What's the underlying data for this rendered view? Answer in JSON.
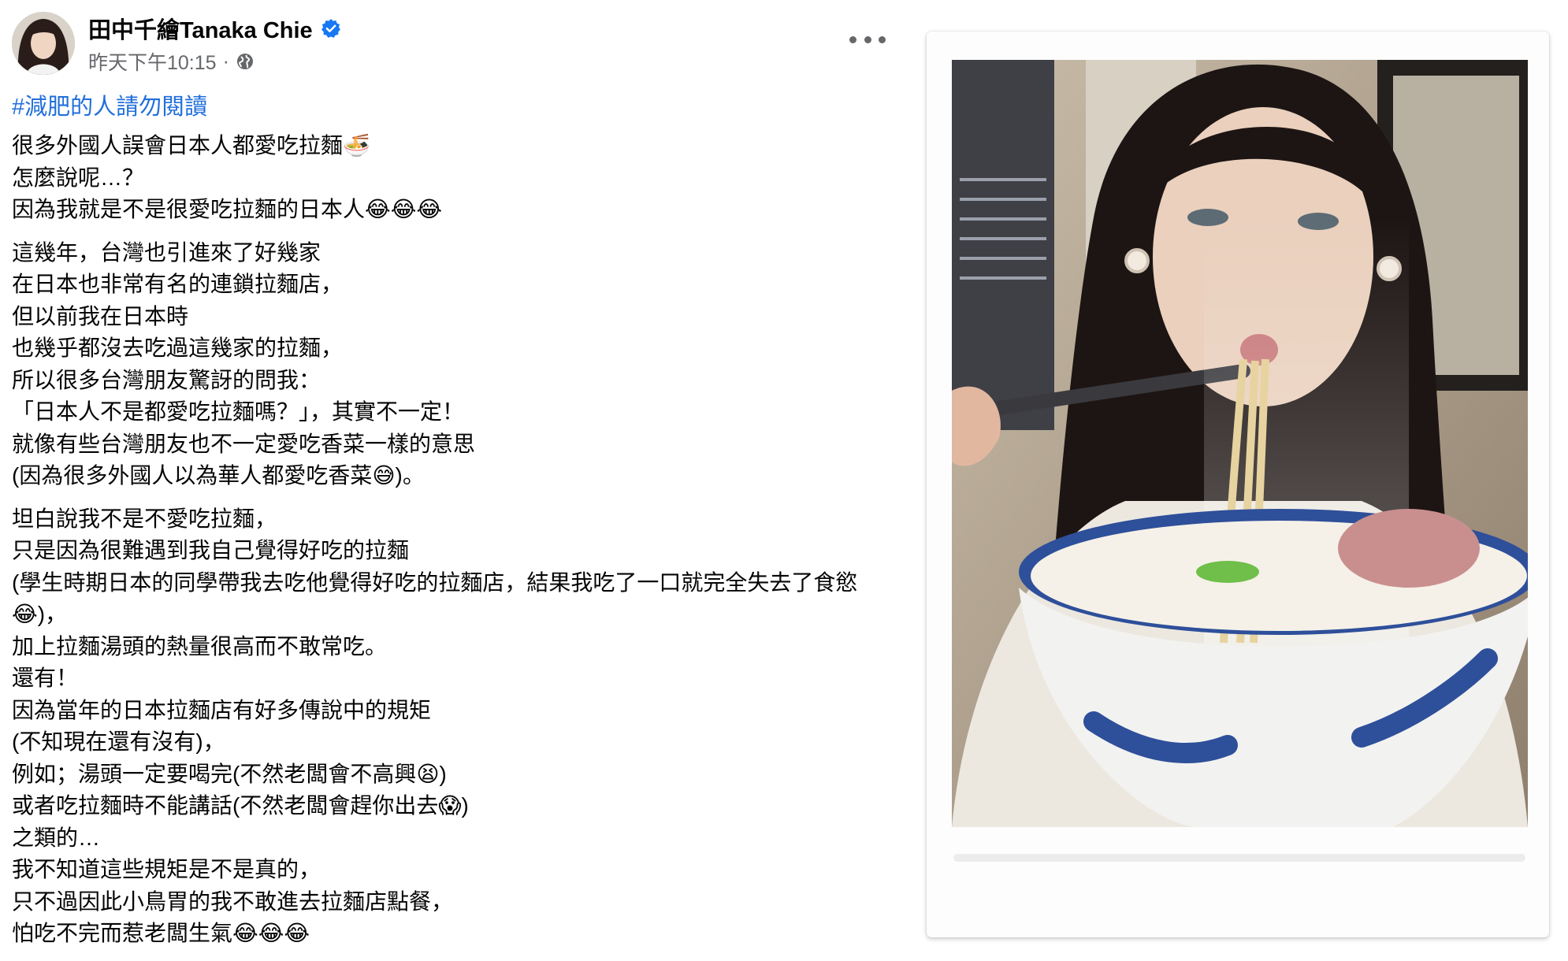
{
  "post": {
    "author_name": "田中千繪Tanaka Chie",
    "verified": true,
    "timestamp": "昨天下午10:15",
    "separator": "·",
    "audience_icon": "globe-icon",
    "hashtag": "#減肥的人請勿閱讀",
    "paragraphs": [
      [
        "很多外國人誤會日本人都愛吃拉麵🍜",
        "怎麼說呢…？",
        "因為我就是不是很愛吃拉麵的日本人😂😂😂"
      ],
      [
        "這幾年，台灣也引進來了好幾家",
        "在日本也非常有名的連鎖拉麵店，",
        "但以前我在日本時",
        "也幾乎都沒去吃過這幾家的拉麵，",
        "所以很多台灣朋友驚訝的問我：",
        "「日本人不是都愛吃拉麵嗎？」，其實不一定！",
        "就像有些台灣朋友也不一定愛吃香菜一樣的意思",
        "(因為很多外國人以為華人都愛吃香菜😅)。"
      ],
      [
        "坦白說我不是不愛吃拉麵，",
        "只是因為很難遇到我自己覺得好吃的拉麵",
        "(學生時期日本的同學帶我去吃他覺得好吃的拉麵店，結果我吃了一口就完全失去了食慾😂)，",
        "加上拉麵湯頭的熱量很高而不敢常吃。",
        "還有！",
        "因為當年的日本拉麵店有好多傳說中的規矩",
        "(不知現在還有沒有)，",
        "例如；湯頭一定要喝完(不然老闆會不高興😫)",
        "或者吃拉麵時不能講話(不然老闆會趕你出去😱)",
        "之類的…",
        "我不知道這些規矩是不是真的，",
        "只不過因此小鳥胃的我不敢進去拉麵店點餐，",
        "怕吃不完而惹老闆生氣😂😂😂"
      ]
    ]
  },
  "colors": {
    "text": "#050505",
    "meta": "#65676b",
    "hashtag": "#216fdb",
    "verified": "#1877f2"
  }
}
